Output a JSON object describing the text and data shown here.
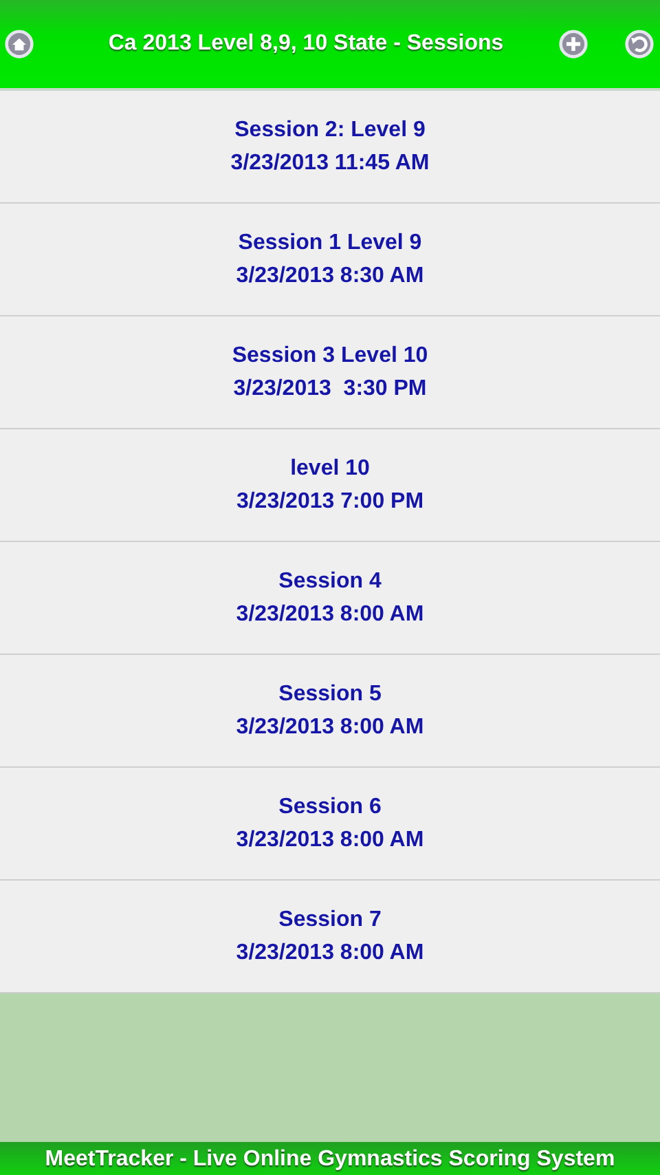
{
  "header": {
    "title": "Ca 2013 Level 8,9, 10 State - Sessions"
  },
  "sessions": [
    {
      "name": "Session 2: Level 9",
      "time": "3/23/2013 11:45 AM"
    },
    {
      "name": "Session 1 Level 9",
      "time": "3/23/2013 8:30 AM"
    },
    {
      "name": "Session 3 Level 10",
      "time": "3/23/2013  3:30 PM"
    },
    {
      "name": "level 10",
      "time": "3/23/2013 7:00 PM"
    },
    {
      "name": "Session 4",
      "time": "3/23/2013 8:00 AM"
    },
    {
      "name": "Session 5",
      "time": "3/23/2013 8:00 AM"
    },
    {
      "name": "Session 6",
      "time": "3/23/2013 8:00 AM"
    },
    {
      "name": "Session 7",
      "time": "3/23/2013 8:00 AM"
    }
  ],
  "footer": {
    "text": "MeetTracker - Live Online Gymnastics Scoring System"
  }
}
